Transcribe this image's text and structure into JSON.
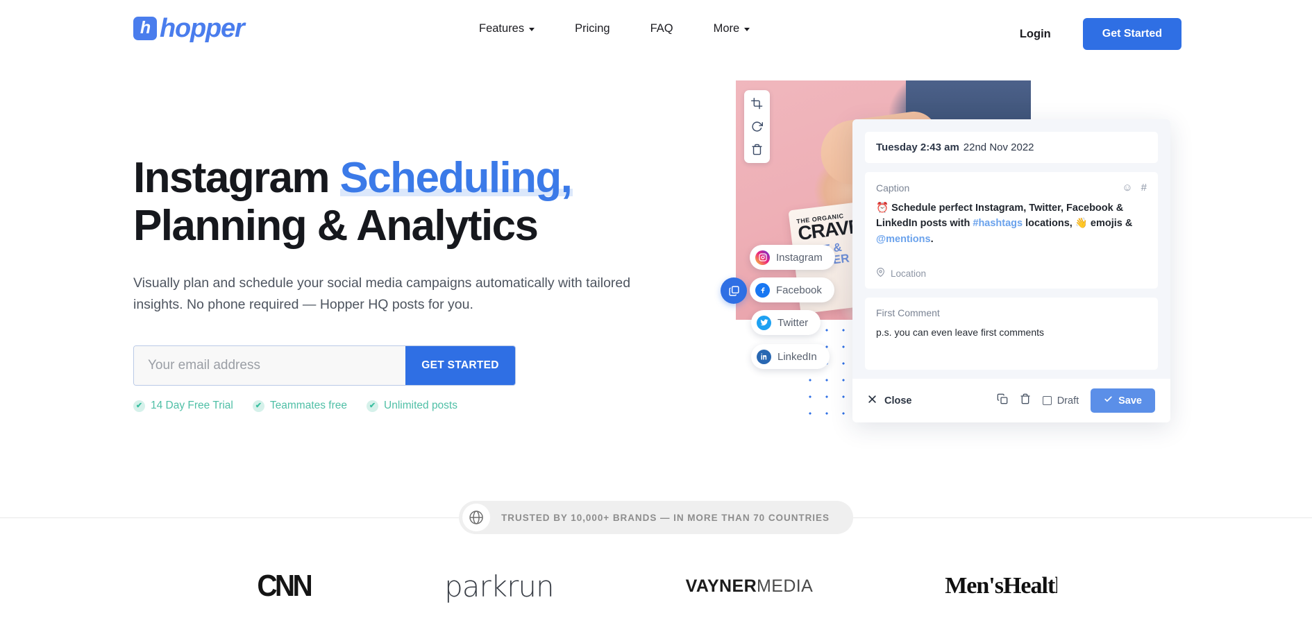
{
  "brand": {
    "logo_mark": "h",
    "logo_text": "hopper",
    "accent_color": "#2f6fe4",
    "logo_color": "#4a7ded"
  },
  "header": {
    "nav": [
      {
        "label": "Features",
        "has_caret": true
      },
      {
        "label": "Pricing",
        "has_caret": false
      },
      {
        "label": "FAQ",
        "has_caret": false
      },
      {
        "label": "More",
        "has_caret": true
      }
    ],
    "login_label": "Login",
    "cta_label": "Get Started"
  },
  "hero": {
    "title_part1": "Instagram ",
    "title_highlight": "Scheduling,",
    "title_part2": "Planning & Analytics",
    "highlight_color": "#3b7ae8",
    "highlight_underline_color": "#dce8fb",
    "subtitle": "Visually plan and schedule your social media campaigns automatically with tailored insights. No phone required — Hopper HQ posts for you.",
    "email_placeholder": "Your email address",
    "email_value": "",
    "submit_label": "GET STARTED",
    "perks": [
      {
        "label": "14 Day Free Trial",
        "check": "✔"
      },
      {
        "label": "Teammates free",
        "check": "✔"
      },
      {
        "label": "Unlimited posts",
        "check": "✔"
      }
    ],
    "perk_color": "#4fbfa6"
  },
  "mock": {
    "image_tools": [
      {
        "name": "crop-icon"
      },
      {
        "name": "rotate-icon"
      },
      {
        "name": "delete-icon"
      }
    ],
    "photo_pack": {
      "line1": "THE ORGANIC",
      "line2": "CRAVE",
      "line3": "SALT & PEPPER"
    },
    "multi_badge_name": "multi-image-icon",
    "platforms": [
      {
        "label": "Instagram",
        "color": "#e1306c"
      },
      {
        "label": "Facebook",
        "color": "#1877f2"
      },
      {
        "label": "Twitter",
        "color": "#1da1f2"
      },
      {
        "label": "LinkedIn",
        "color": "#2867b2"
      }
    ],
    "panel": {
      "day_time": "Tuesday 2:43 am",
      "date": "22nd Nov 2022",
      "caption_label": "Caption",
      "caption_emoji_icon": "☺",
      "caption_hash_icon": "#",
      "caption_prefix": "⏰ Schedule perfect Instagram, Twitter, Facebook & LinkedIn posts with ",
      "caption_hashtag": "#hashtags",
      "caption_middle": " locations, 👋 emojis & ",
      "caption_mention": "@mentions",
      "caption_suffix": ".",
      "location_label": "Location",
      "first_comment_label": "First Comment",
      "first_comment_value": "p.s. you can even leave first comments",
      "close_label": "Close",
      "draft_label": "Draft",
      "save_label": "Save",
      "duplicate_icon": "duplicate-icon",
      "trash_icon": "trash-icon"
    }
  },
  "trust": {
    "icon": "globe-icon",
    "text": "TRUSTED BY 10,000+ BRANDS — IN MORE THAN 70 COUNTRIES"
  },
  "logos": [
    {
      "name": "cnn",
      "label": "CNN"
    },
    {
      "name": "parkrun",
      "label": "parkrun"
    },
    {
      "name": "vaynermedia",
      "label_bold": "VAYNER",
      "label_light": "MEDIA"
    },
    {
      "name": "menshealth",
      "label": "Men'sHealth"
    }
  ]
}
